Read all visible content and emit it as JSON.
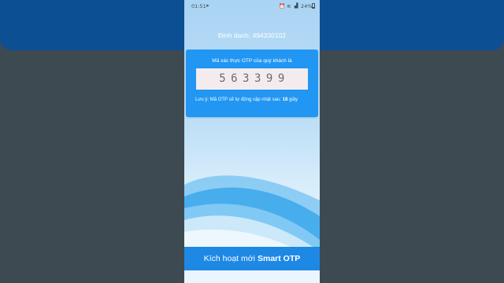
{
  "status_bar": {
    "time": "01:51",
    "battery": "24%"
  },
  "identifier": {
    "label": "Định danh:",
    "value": "494330102"
  },
  "otp_card": {
    "title": "Mã xác thực OTP của quý khách là",
    "code": "563399",
    "note_prefix": "Lưu ý: Mã OTP sẽ tự động cập nhật sau:",
    "countdown": "18",
    "note_suffix": "giây"
  },
  "activate": {
    "label_prefix": "Kích hoạt mới",
    "label_strong": "Smart OTP"
  },
  "colors": {
    "card": "#2196f3",
    "button": "#1e88e5",
    "backdrop_top": "#0d4f93",
    "backdrop": "#3e4a52"
  },
  "icons": [
    "send-icon",
    "alarm-icon",
    "wifi-icon",
    "signal-icon",
    "battery-icon"
  ]
}
